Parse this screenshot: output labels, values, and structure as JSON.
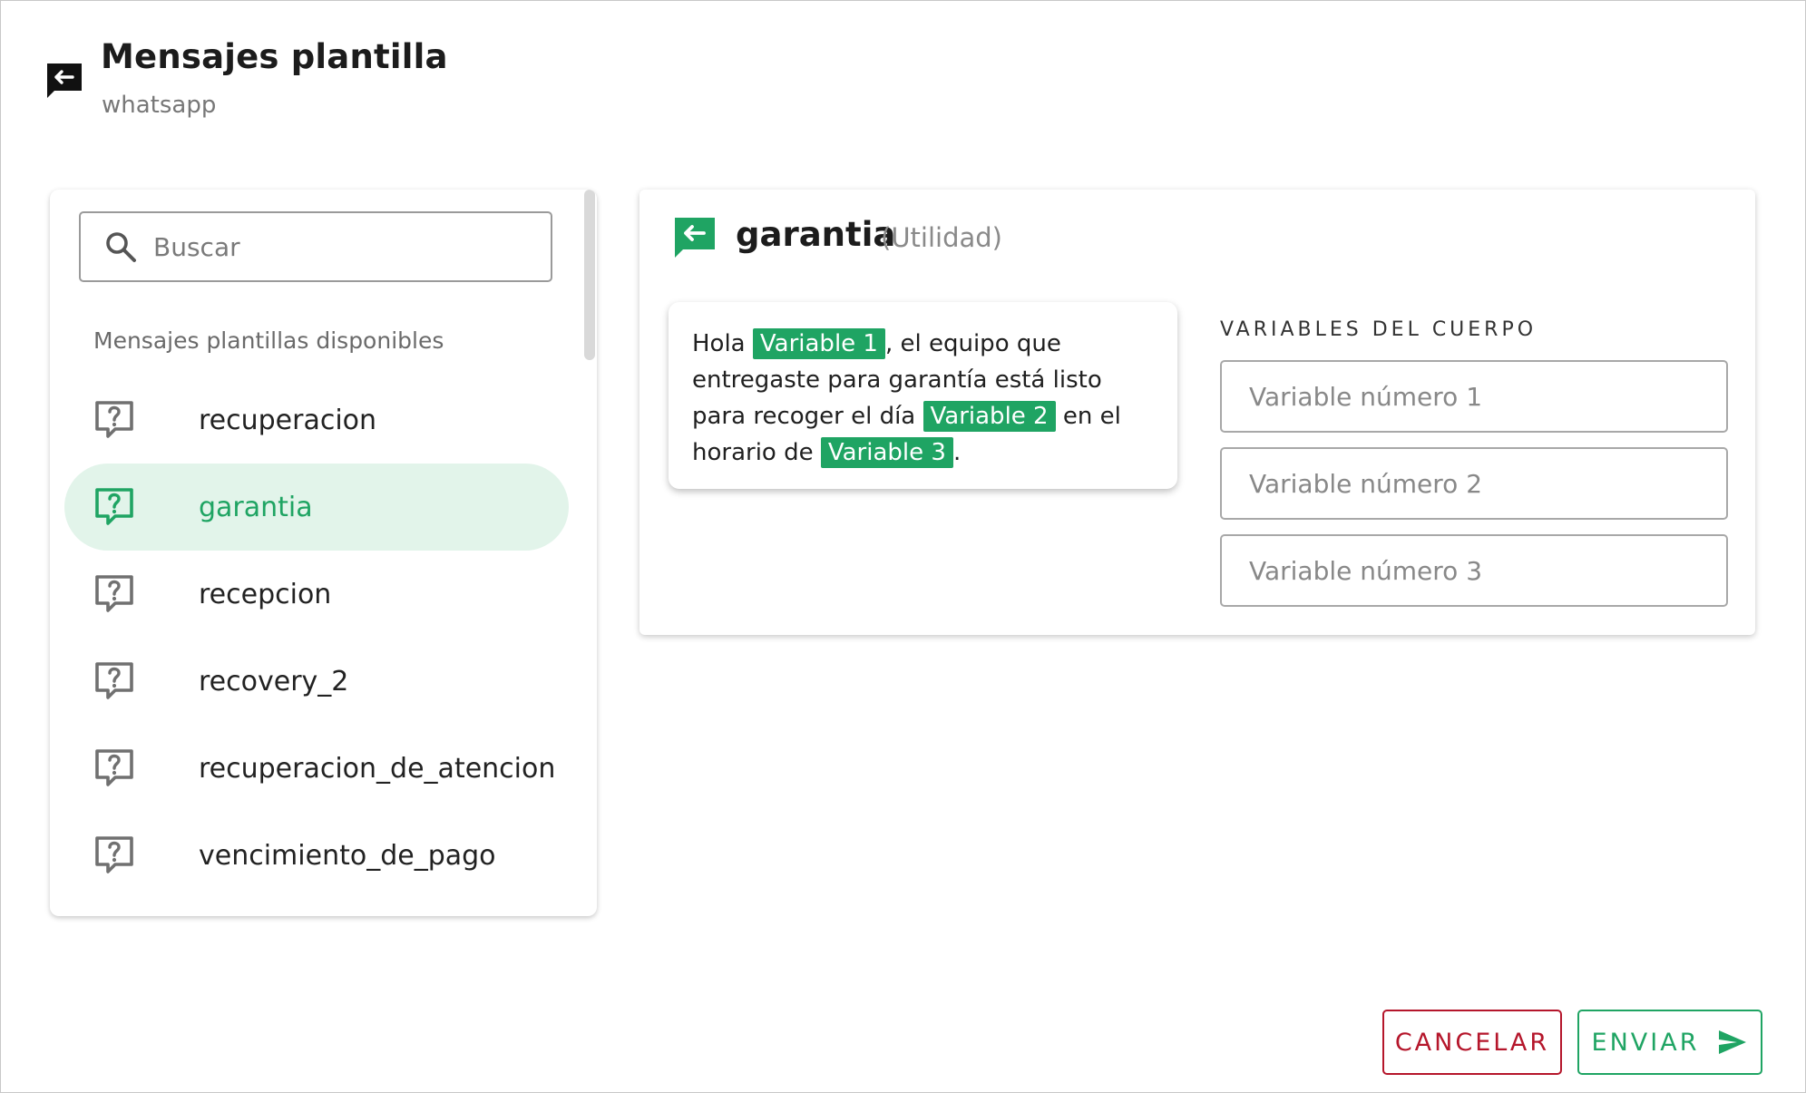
{
  "header": {
    "title": "Mensajes plantilla",
    "subtitle": "whatsapp",
    "icon": "reply-message-icon"
  },
  "search": {
    "placeholder": "Buscar",
    "value": ""
  },
  "list": {
    "caption": "Mensajes plantillas disponibles",
    "items": [
      {
        "label": "recuperacion",
        "icon": "question-bubble-icon",
        "selected": false
      },
      {
        "label": "garantia",
        "icon": "question-bubble-icon",
        "selected": true
      },
      {
        "label": "recepcion",
        "icon": "question-bubble-icon",
        "selected": false
      },
      {
        "label": "recovery_2",
        "icon": "question-bubble-icon",
        "selected": false
      },
      {
        "label": "recuperacion_de_atencion",
        "icon": "question-bubble-icon",
        "selected": false
      },
      {
        "label": "vencimiento_de_pago",
        "icon": "question-bubble-icon",
        "selected": false
      }
    ]
  },
  "template": {
    "name": "garantia",
    "category": "(Utilidad)",
    "icon": "reply-message-icon",
    "body": {
      "t1": "Hola ",
      "v1": "Variable 1",
      "t2": ", el equipo que entregaste para garantía está listo para recoger el día ",
      "v2": "Variable 2",
      "t3": " en el horario de ",
      "v3": "Variable 3",
      "t4": "."
    }
  },
  "variables": {
    "heading": "VARIABLES DEL CUERPO",
    "inputs": [
      {
        "placeholder": "Variable número 1",
        "value": ""
      },
      {
        "placeholder": "Variable número 2",
        "value": ""
      },
      {
        "placeholder": "Variable número 3",
        "value": ""
      }
    ]
  },
  "actions": {
    "cancel_label": "CANCELAR",
    "send_label": "ENVIAR"
  },
  "colors": {
    "accent": "#1fa463",
    "selected_bg": "#e2f4ea",
    "danger": "#b5162b",
    "header_icon": "#111111"
  }
}
